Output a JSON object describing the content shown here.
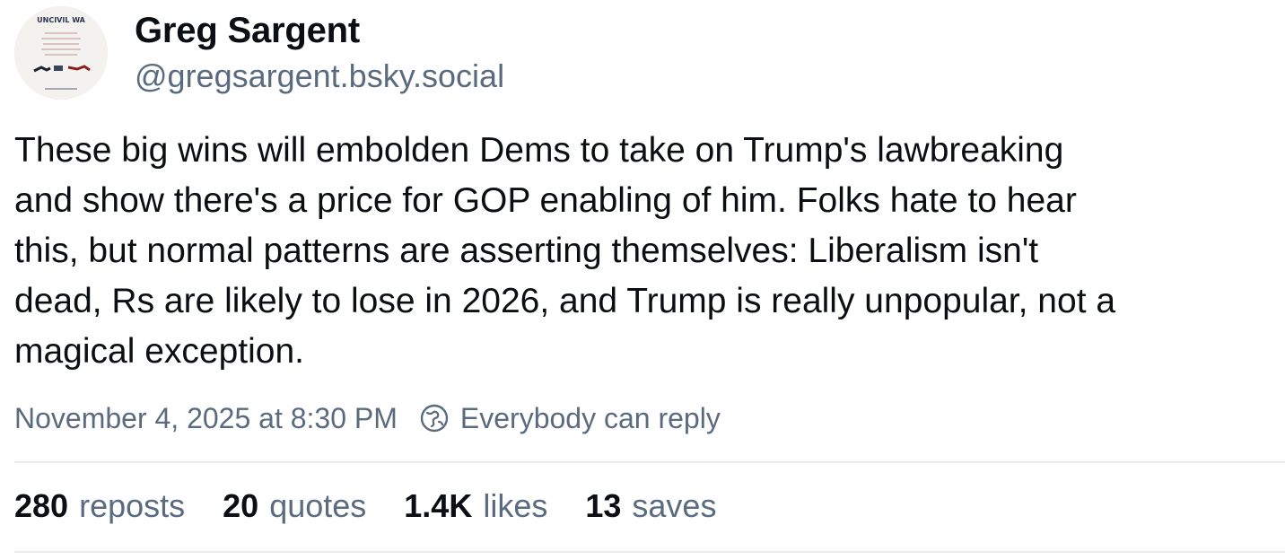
{
  "author": {
    "display_name": "Greg Sargent",
    "handle": "@gregsargent.bsky.social",
    "avatar_icon": "book-cover-avatar",
    "avatar_text": "UNCIVIL WA"
  },
  "post": {
    "text_lines": [
      "These big wins will embolden Dems to take on Trump's lawbreaking",
      "and show there's a price for GOP enabling of him. Folks hate to hear",
      "this, but normal patterns are asserting themselves: Liberalism isn't",
      "dead, Rs are likely to lose in 2026, and Trump is really unpopular, not a",
      "magical exception."
    ],
    "timestamp": "November 4, 2025 at 8:30 PM",
    "reply_icon": "globe-reply-icon",
    "reply_setting": "Everybody can reply"
  },
  "stats": {
    "reposts": {
      "count": "280",
      "label": "reposts"
    },
    "quotes": {
      "count": "20",
      "label": "quotes"
    },
    "likes": {
      "count": "1.4K",
      "label": "likes"
    },
    "saves": {
      "count": "13",
      "label": "saves"
    }
  },
  "colors": {
    "primary_text": "#0b0f14",
    "secondary_text": "#5b6b7f",
    "divider": "#e8ecf0",
    "background": "#ffffff"
  }
}
